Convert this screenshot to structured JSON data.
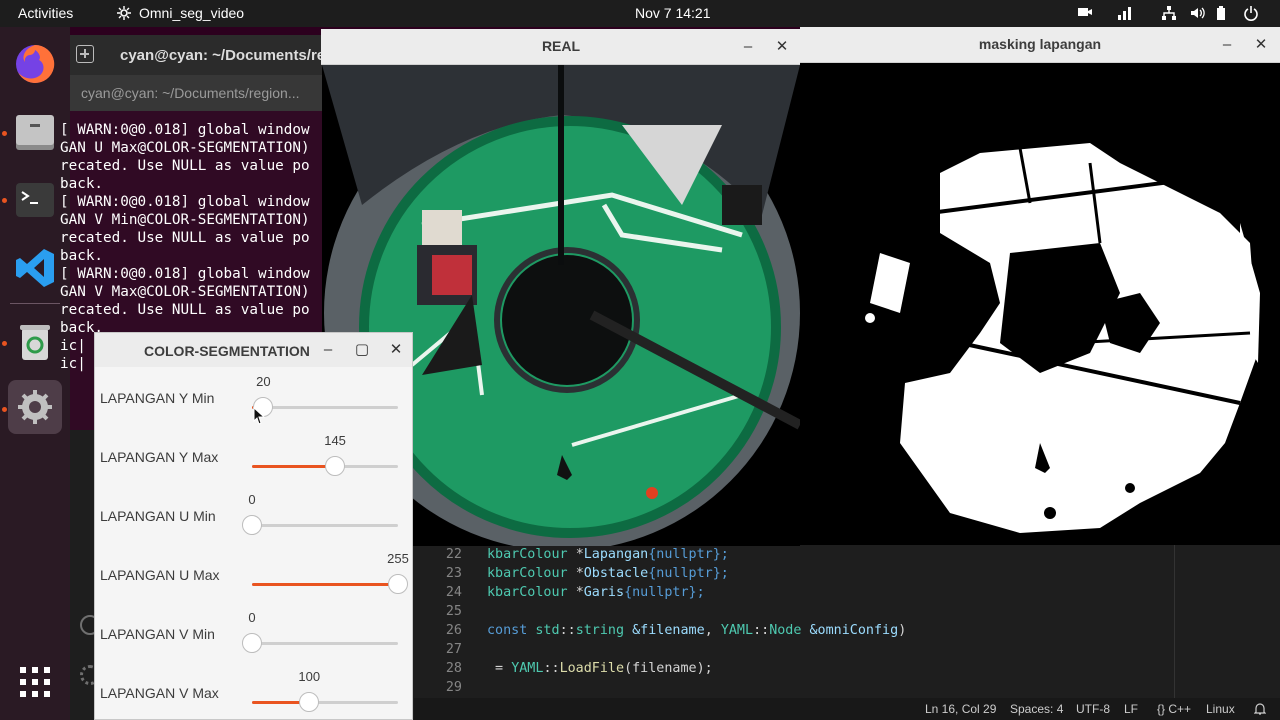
{
  "topbar": {
    "activities": "Activities",
    "app_name": "Omni_seg_video",
    "clock": "Nov 7  14:21"
  },
  "terminal": {
    "title": "cyan@cyan: ~/Documents/re",
    "tab": "cyan@cyan: ~/Documents/region...",
    "lines": [
      "[ WARN:0@0.018] global window",
      "GAN U Max@COLOR-SEGMENTATION)",
      "recated. Use NULL as value po",
      "back.",
      "[ WARN:0@0.018] global window",
      "GAN V Min@COLOR-SEGMENTATION)",
      "recated. Use NULL as value po",
      "back.",
      "[ WARN:0@0.018] global window",
      "GAN V Max@COLOR-SEGMENTATION)",
      "recated. Use NULL as value po",
      "back.",
      "ic|",
      "ic|"
    ]
  },
  "real_window": {
    "title": "REAL"
  },
  "mask_window": {
    "title": "masking lapangan"
  },
  "color_seg": {
    "title": "COLOR-SEGMENTATION",
    "trackbars": [
      {
        "label": "LAPANGAN Y Min",
        "value": "20",
        "fraction": 0.078
      },
      {
        "label": "LAPANGAN Y Max",
        "value": "145",
        "fraction": 0.569
      },
      {
        "label": "LAPANGAN U Min",
        "value": "0",
        "fraction": 0.0
      },
      {
        "label": "LAPANGAN U Max",
        "value": "255",
        "fraction": 1.0
      },
      {
        "label": "LAPANGAN V Min",
        "value": "0",
        "fraction": 0.0
      },
      {
        "label": "LAPANGAN V Max",
        "value": "100",
        "fraction": 0.392
      }
    ]
  },
  "editor": {
    "lines": [
      {
        "num": "22",
        "tokens": [
          [
            "kbarColour ",
            "#4ec9b0"
          ],
          [
            "*",
            "#d4d4d4"
          ],
          [
            "Lapangan",
            "#9cdcfe"
          ],
          [
            "{nullptr};",
            "#569cd6"
          ]
        ]
      },
      {
        "num": "23",
        "tokens": [
          [
            "kbarColour ",
            "#4ec9b0"
          ],
          [
            "*",
            "#d4d4d4"
          ],
          [
            "Obstacle",
            "#9cdcfe"
          ],
          [
            "{nullptr};",
            "#569cd6"
          ]
        ]
      },
      {
        "num": "24",
        "tokens": [
          [
            "kbarColour ",
            "#4ec9b0"
          ],
          [
            "*",
            "#d4d4d4"
          ],
          [
            "Garis",
            "#9cdcfe"
          ],
          [
            "{nullptr};",
            "#569cd6"
          ]
        ]
      },
      {
        "num": "25",
        "tokens": []
      },
      {
        "num": "26",
        "tokens": [
          [
            "const ",
            "#569cd6"
          ],
          [
            "std",
            "#4ec9b0"
          ],
          [
            "::",
            "#d4d4d4"
          ],
          [
            "string ",
            "#4ec9b0"
          ],
          [
            "&filename",
            "#9cdcfe"
          ],
          [
            ", ",
            "#d4d4d4"
          ],
          [
            "YAML",
            "#4ec9b0"
          ],
          [
            "::",
            "#d4d4d4"
          ],
          [
            "Node ",
            "#4ec9b0"
          ],
          [
            "&omniConfig",
            "#9cdcfe"
          ],
          [
            ")",
            "#d4d4d4"
          ]
        ]
      },
      {
        "num": "27",
        "tokens": []
      },
      {
        "num": "28",
        "tokens": [
          [
            " = ",
            "#d4d4d4"
          ],
          [
            "YAML",
            "#4ec9b0"
          ],
          [
            "::",
            "#d4d4d4"
          ],
          [
            "LoadFile",
            "#dcdcaa"
          ],
          [
            "(filename);",
            "#d4d4d4"
          ]
        ]
      },
      {
        "num": "29",
        "tokens": []
      }
    ]
  },
  "statusbar": {
    "position": "Ln 16, Col 29",
    "spaces": "Spaces: 4",
    "encoding": "UTF-8",
    "eol": "LF",
    "language": "{} C++",
    "os": "Linux"
  }
}
